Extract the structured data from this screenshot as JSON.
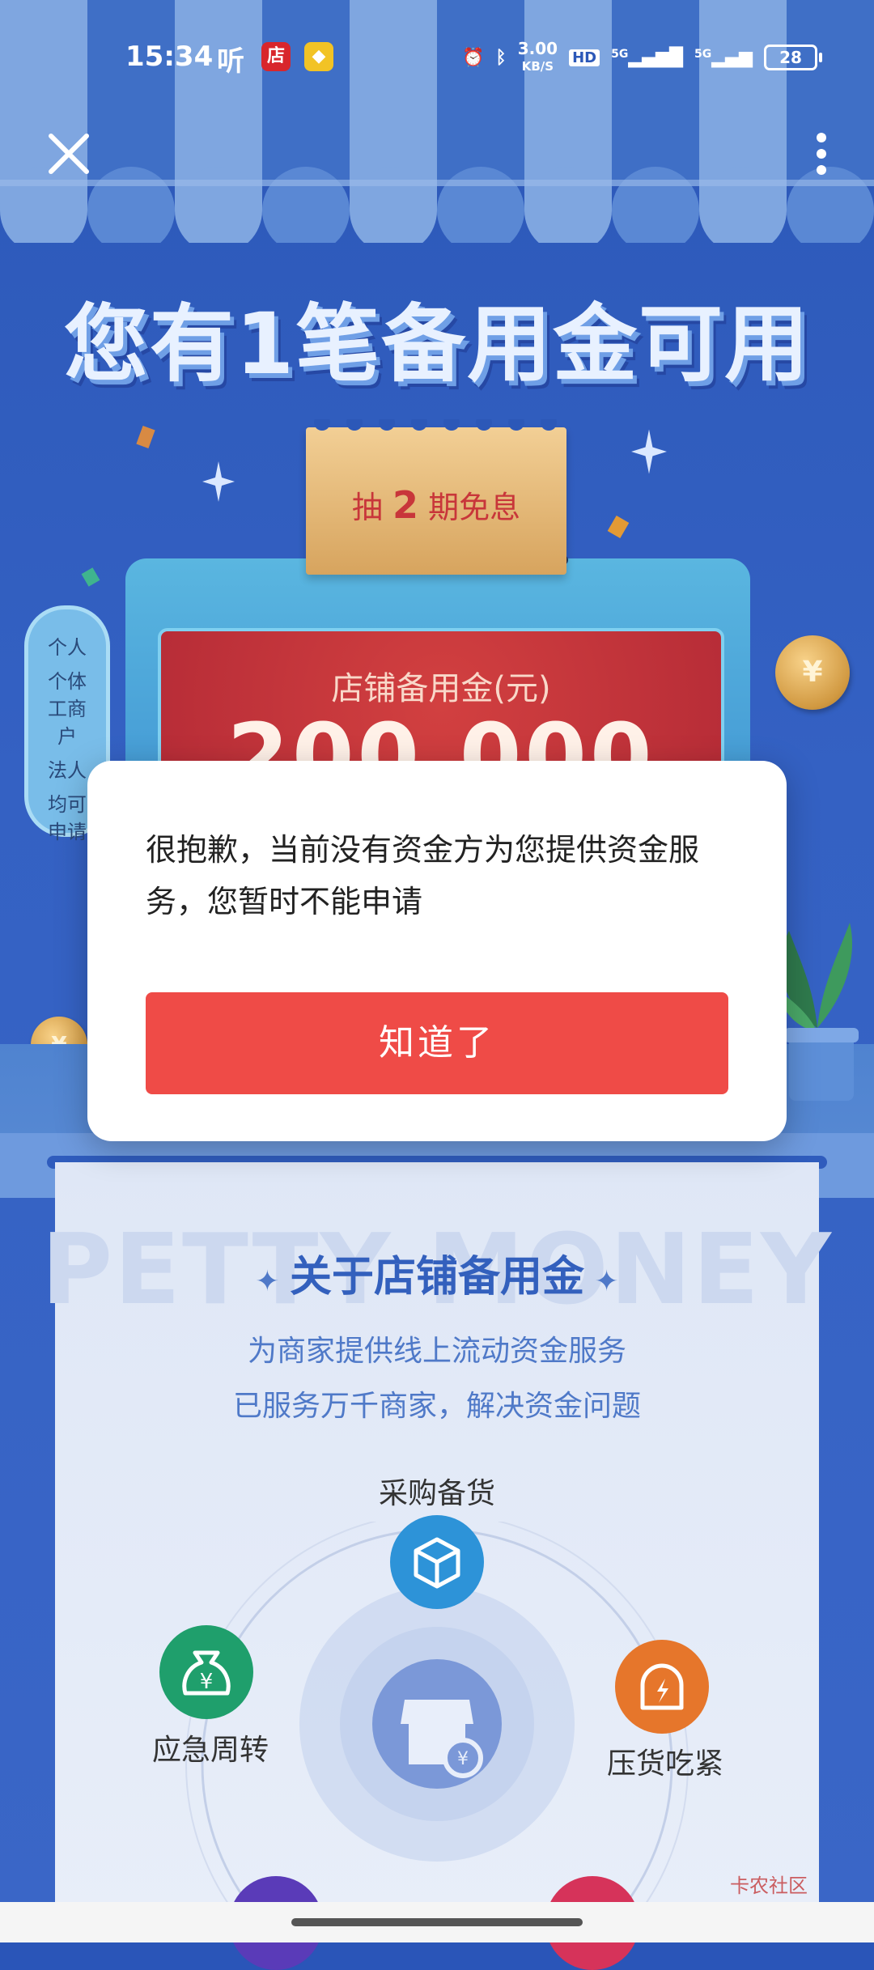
{
  "status_bar": {
    "time": "15:34",
    "listen_glyph": "听",
    "app1_glyph": "店",
    "app2_glyph": "",
    "net_speed_value": "3.00",
    "net_speed_unit": "KB/S",
    "hd_label": "HD",
    "signal1_label": "5G",
    "signal2_label": "5G",
    "battery": "28"
  },
  "hero": {
    "headline": "您有1笔备用金可用",
    "ticket_prefix": "抽",
    "ticket_number": "2",
    "ticket_suffix": "期免息",
    "screen_label": "店铺备用金(元)",
    "screen_amount": "200,000"
  },
  "tags": [
    "个人",
    "个体工商户",
    "法人",
    "均可申请"
  ],
  "about": {
    "watermark": "PETTY MONEY",
    "title": "关于店铺备用金",
    "line1": "为商家提供线上流动资金服务",
    "line2": "已服务万千商家，解决资金问题"
  },
  "services": [
    {
      "label": "采购备货",
      "icon": "box-icon",
      "color": "#2d93d8"
    },
    {
      "label": "应急周转",
      "icon": "money-bag-icon",
      "color": "#1f9f6c"
    },
    {
      "label": "压货吃紧",
      "icon": "warehouse-icon",
      "color": "#e6762b"
    }
  ],
  "dialog": {
    "message": "很抱歉，当前没有资金方为您提供资金服务，您暂时不能申请",
    "button_label": "知道了"
  },
  "brand_watermark": "卡农社区",
  "colors": {
    "primary_blue": "#2c58b8",
    "accent_red": "#ef4b47",
    "gold": "#d7a45e"
  }
}
